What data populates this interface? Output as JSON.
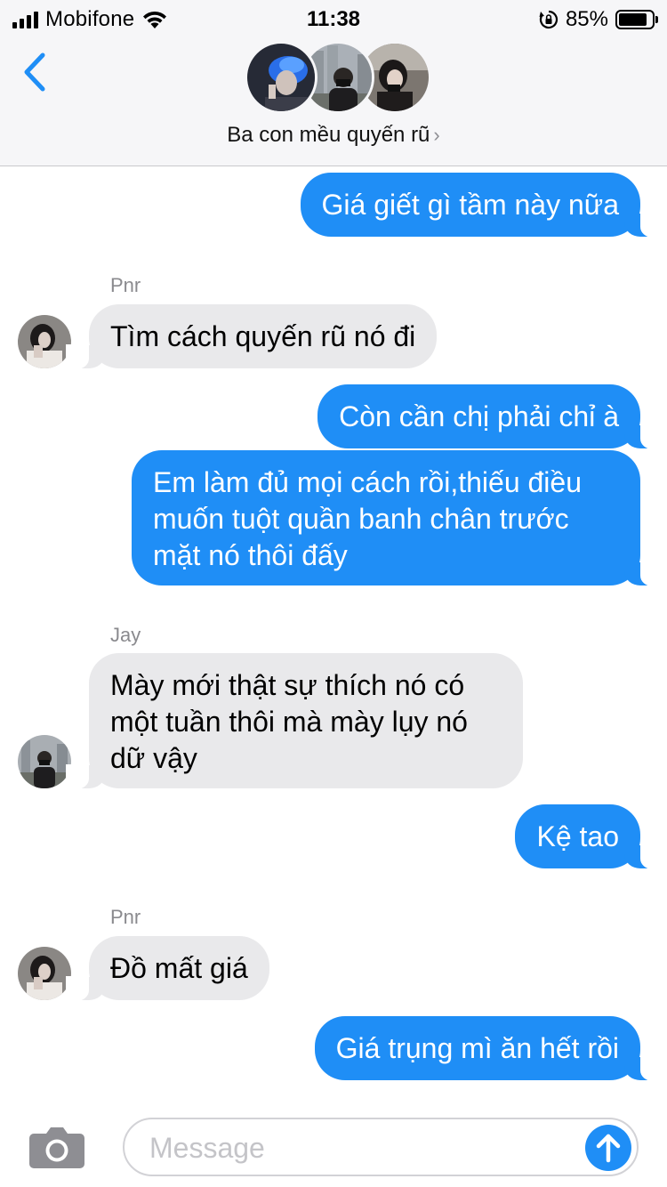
{
  "status_bar": {
    "carrier": "Mobifone",
    "time": "11:38",
    "battery": "85%",
    "battery_level": 0.85
  },
  "header": {
    "group_name": "Ba con mều quyến rũ",
    "chevron": "›"
  },
  "messages": [
    {
      "from": "me",
      "text": "Giá giết gì tầm này nữa"
    },
    {
      "from": "Pnr",
      "sender_label": "Pnr",
      "text": "Tìm cách quyến rũ nó đi"
    },
    {
      "from": "me",
      "text": "Còn cần chị phải chỉ à"
    },
    {
      "from": "me",
      "text": "Em làm đủ mọi cách rồi,thiếu điều\nmuốn tuột quần banh chân trước\nmặt nó thôi đấy"
    },
    {
      "from": "Jay",
      "sender_label": "Jay",
      "text": "Mày mới thật sự thích nó có\nmột tuần thôi mà mày lụy nó\ndữ vậy"
    },
    {
      "from": "me",
      "text": "Kệ tao"
    },
    {
      "from": "Pnr",
      "sender_label": "Pnr",
      "text": "Đồ mất giá"
    },
    {
      "from": "me",
      "text": "Giá trụng mì ăn hết rồi"
    }
  ],
  "composer": {
    "placeholder": "Message"
  },
  "colors": {
    "outgoing_bubble": "#1f8ef6",
    "incoming_bubble": "#e9e9eb",
    "accent": "#1f8ef6"
  },
  "icons": [
    "back-chevron-icon",
    "wifi-icon",
    "rotation-lock-icon",
    "battery-icon",
    "camera-icon",
    "send-arrow-icon"
  ]
}
